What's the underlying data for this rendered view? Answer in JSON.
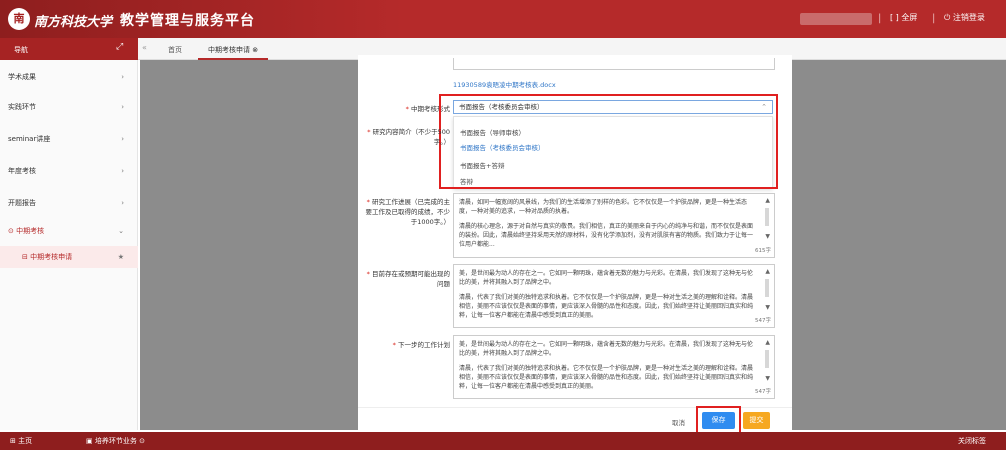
{
  "header": {
    "logo_char": "南",
    "school_name": "南方科技大学",
    "platform_title": "教学管理与服务平台",
    "fullscreen": "[ ] 全屏",
    "logout": "⏻ 注销登录",
    "separator": "|"
  },
  "nav": {
    "title": "导航",
    "expand_icon": "⤢"
  },
  "tabs": [
    {
      "label": "首页"
    },
    {
      "label": "中期考核申请 ⊗"
    }
  ],
  "sidebar": {
    "items": [
      {
        "label": "学术成果",
        "arrow": "›"
      },
      {
        "label": "实践环节",
        "arrow": "›"
      },
      {
        "label": "seminar讲座",
        "arrow": "›"
      },
      {
        "label": "年度考核",
        "arrow": "›"
      },
      {
        "label": "开题报告",
        "arrow": "›"
      },
      {
        "label": "⊙ 中期考核",
        "arrow": "⌄"
      },
      {
        "label": "⊟ 中期考核申请",
        "arrow": "★"
      }
    ]
  },
  "modal": {
    "attachment": "11930589袁晤凌中期考核表.docx",
    "form_label": "中期考核形式",
    "form_value": "书面报告（考核委员会审核）",
    "options": [
      "书面报告（导师审核）",
      "书面报告（考核委员会审核）",
      "书面报告+答辩",
      "答辩"
    ],
    "research_label": "研究内容简介（不少于500字。）",
    "work_label": "研究工作进展（已完成的主要工作及已取得的成绩，不少于1000字。）",
    "work_text_1": "清晨，如同一幅宽阔的风景线，为我们的生活增添了别样的色彩。它不仅仅是一个护肤品牌，更是一种生活态度，一种对美的追求，一种对品质的执着。",
    "work_text_2": "清晨的核心理念，源于对自然与真实的敬畏。我们相信，真正的美丽来自于内心的纯净与和谐，而不仅仅是表面的装扮。因此，清晨始终坚持采用天然的原材料，没有化学添加剂，没有对肌肤有害的物质。我们致力于让每一位用户都能...",
    "work_count": "615字",
    "problem_label": "目前存在或预期可能出现的问题",
    "problem_text_1": "美，是世间最为动人的存在之一。它如同一颗明珠，蕴含着无数的魅力与光彩。在清晨，我们发现了这种无与伦比的美，并将其融入到了品牌之中。",
    "problem_text_2": "清晨，代表了我们对美的独特追求和执着。它不仅仅是一个护肤品牌，更是一种对生活之美的理解和诠释。清晨相信，美丽不应该仅仅是表面的事情，更应该深入骨髓的品性和态度。因此，我们始终坚持让美丽回归真实和纯粹，让每一位客户都能在清晨中感受到真正的美丽。",
    "problem_count": "547字",
    "plan_label": "下一步的工作计划",
    "plan_text_1": "美，是世间最为动人的存在之一。它如同一颗明珠，蕴含着无数的魅力与光彩。在清晨，我们发现了这种无与伦比的美，并将其融入到了品牌之中。",
    "plan_text_2": "清晨，代表了我们对美的独特追求和执着。它不仅仅是一个护肤品牌，更是一种对生活之美的理解和诠释。清晨相信，美丽不应该仅仅是表面的事情，更应该深入骨髓的品性和态度。因此，我们始终坚持让美丽回归真实和纯粹，让每一位客户都能在清晨中感受到真正的美丽。",
    "plan_count": "547字",
    "cancel": "取消",
    "save": "保存",
    "submit": "提交"
  },
  "footer": {
    "home": "⊞ 主页",
    "task": "▣ 培养环节业务 ⊙",
    "close_tabs": "关闭标签"
  }
}
